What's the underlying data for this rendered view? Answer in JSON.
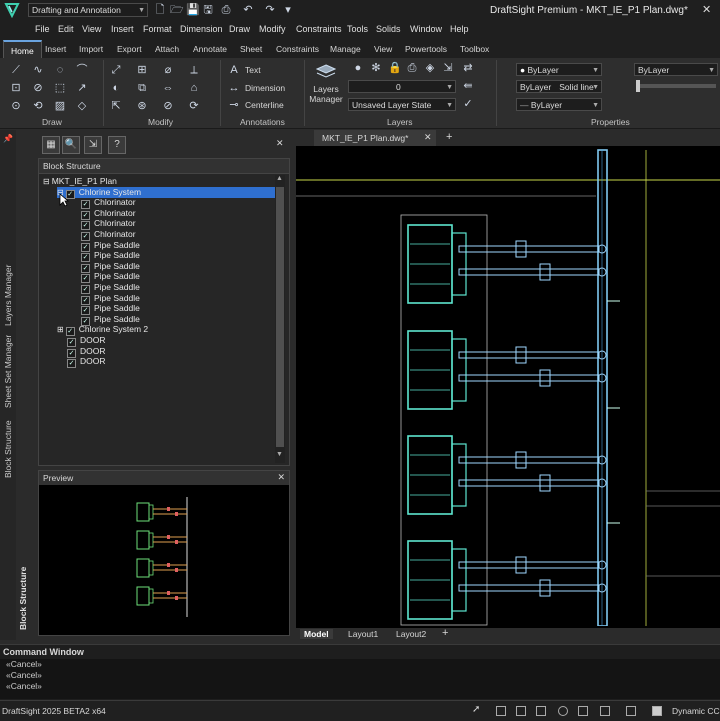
{
  "title_bar": {
    "workspace": "Drafting and Annotation",
    "app_title": "DraftSight Premium - MKT_IE_P1 Plan.dwg*"
  },
  "menu": [
    "File",
    "Edit",
    "View",
    "Insert",
    "Format",
    "Dimension",
    "Draw",
    "Modify",
    "Constraints",
    "Tools",
    "Solids",
    "Window",
    "Help"
  ],
  "ribbon_tabs": [
    "Home",
    "Insert",
    "Import",
    "Export",
    "Attach",
    "Annotate",
    "Sheet",
    "Constraints",
    "Manage",
    "View",
    "Powertools",
    "Toolbox"
  ],
  "ribbon": {
    "groups": [
      "Draw",
      "Modify",
      "Annotations",
      "Layers",
      "Properties"
    ],
    "annotations": {
      "text": "Text",
      "dimension": "Dimension",
      "centerline": "Centerline"
    },
    "layers": {
      "manager": "Layers Manager",
      "layer_value": "0",
      "layer_state": "Unsaved Layer State"
    },
    "properties": {
      "color": "ByLayer",
      "color2": "ByLayer",
      "linestyle": "Solid line",
      "lineweight": "ByLayer",
      "right_combo": "ByLayer"
    }
  },
  "left_strip": {
    "tabs": [
      "Layers Manager",
      "Sheet Set Manager",
      "Block Structure"
    ]
  },
  "panel": {
    "title": "Block Structure",
    "tree": [
      {
        "label": "MKT_IE_P1 Plan",
        "level": 0,
        "exp": "⊟",
        "checked": false
      },
      {
        "label": "Chlorine System",
        "level": 1,
        "exp": "⊟",
        "checked": true,
        "selected": true
      },
      {
        "label": "Chlorinator",
        "level": 2,
        "checked": true
      },
      {
        "label": "Chlorinator",
        "level": 2,
        "checked": true
      },
      {
        "label": "Chlorinator",
        "level": 2,
        "checked": true
      },
      {
        "label": "Chlorinator",
        "level": 2,
        "checked": true
      },
      {
        "label": "Pipe Saddle",
        "level": 2,
        "checked": true
      },
      {
        "label": "Pipe Saddle",
        "level": 2,
        "checked": true
      },
      {
        "label": "Pipe Saddle",
        "level": 2,
        "checked": true
      },
      {
        "label": "Pipe Saddle",
        "level": 2,
        "checked": true
      },
      {
        "label": "Pipe Saddle",
        "level": 2,
        "checked": true
      },
      {
        "label": "Pipe Saddle",
        "level": 2,
        "checked": true
      },
      {
        "label": "Pipe Saddle",
        "level": 2,
        "checked": true
      },
      {
        "label": "Pipe Saddle",
        "level": 2,
        "checked": true
      },
      {
        "label": "Chlorine System 2",
        "level": 1,
        "exp": "⊞",
        "checked": true
      },
      {
        "label": "DOOR",
        "level": 1,
        "checked": true
      },
      {
        "label": "DOOR",
        "level": 1,
        "checked": true
      },
      {
        "label": "DOOR",
        "level": 1,
        "checked": true
      }
    ],
    "preview_title": "Preview",
    "side_label": "Block Structure"
  },
  "drawing": {
    "doc_tab": "MKT_IE_P1 Plan.dwg*",
    "layout_tabs": [
      "Model",
      "Layout1",
      "Layout2"
    ]
  },
  "command": {
    "title": "Command Window",
    "lines": [
      "«Cancel»",
      "«Cancel»",
      "«Cancel»"
    ]
  },
  "status": {
    "version": "DraftSight 2025 BETA2 x64",
    "right": "Dynamic CCS"
  }
}
